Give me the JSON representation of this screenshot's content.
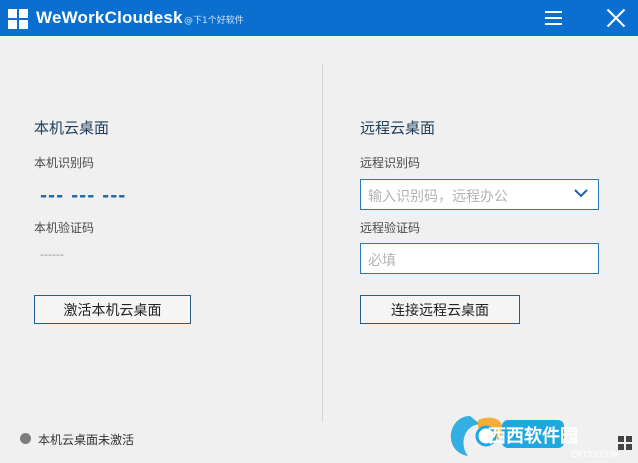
{
  "titlebar": {
    "app_title": "WeWorkCloudesk",
    "watermark": "@下1个好软件",
    "icons": [
      "logo-icon",
      "menu-icon",
      "close-icon"
    ]
  },
  "local": {
    "title": "本机云桌面",
    "id_label": "本机识别码",
    "id_value": "--- --- ---",
    "verify_label": "本机验证码",
    "verify_value": "------",
    "activate_button": "激活本机云桌面"
  },
  "remote": {
    "title": "远程云桌面",
    "id_label": "远程识别码",
    "id_placeholder": "输入识别码，远程办公",
    "verify_label": "远程验证码",
    "verify_placeholder": "必填",
    "connect_button": "连接远程云桌面"
  },
  "status": {
    "text": "本机云桌面未激活"
  },
  "watermark_logo": {
    "text": "西西软件园",
    "url_text": "CR173.COM"
  },
  "colors": {
    "titlebar": "#0a6fce",
    "accent": "#1a63a8",
    "border": "#2f78b7"
  }
}
